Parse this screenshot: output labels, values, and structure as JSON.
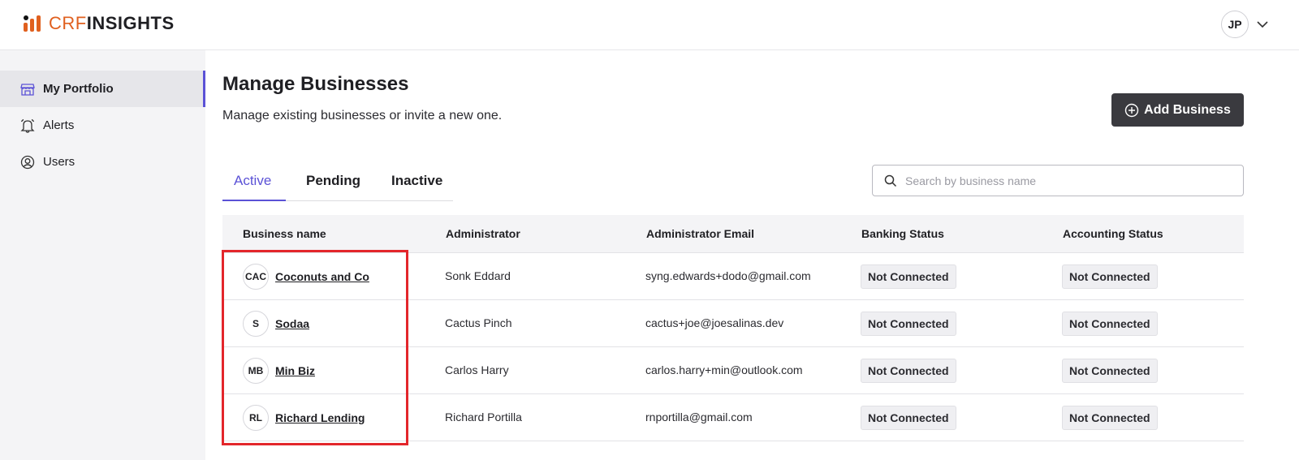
{
  "brand": {
    "part1": "CRF",
    "part2": "INSIGHTS",
    "accent": "#e0601f"
  },
  "user": {
    "initials": "JP"
  },
  "sidebar": {
    "items": [
      {
        "label": "My Portfolio",
        "icon": "storefront-icon",
        "active": true
      },
      {
        "label": "Alerts",
        "icon": "bell-icon",
        "active": false
      },
      {
        "label": "Users",
        "icon": "user-circle-icon",
        "active": false
      }
    ]
  },
  "page": {
    "title": "Manage Businesses",
    "subtitle": "Manage existing businesses or invite a new one.",
    "add_button": "Add Business"
  },
  "tabs": [
    {
      "label": "Active",
      "active": true
    },
    {
      "label": "Pending",
      "active": false
    },
    {
      "label": "Inactive",
      "active": false
    }
  ],
  "search": {
    "placeholder": "Search by business name",
    "value": ""
  },
  "table": {
    "columns": [
      "Business name",
      "Administrator",
      "Administrator Email",
      "Banking Status",
      "Accounting Status"
    ],
    "rows": [
      {
        "initials": "CAC",
        "name": "Coconuts and Co",
        "admin": "Sonk Eddard",
        "email": "syng.edwards+dodo@gmail.com",
        "banking": "Not Connected",
        "accounting": "Not Connected"
      },
      {
        "initials": "S",
        "name": "Sodaa",
        "admin": "Cactus Pinch",
        "email": "cactus+joe@joesalinas.dev",
        "banking": "Not Connected",
        "accounting": "Not Connected"
      },
      {
        "initials": "MB",
        "name": "Min Biz",
        "admin": "Carlos Harry",
        "email": "carlos.harry+min@outlook.com",
        "banking": "Not Connected",
        "accounting": "Not Connected"
      },
      {
        "initials": "RL",
        "name": "Richard Lending",
        "admin": "Richard Portilla",
        "email": "rnportilla@gmail.com",
        "banking": "Not Connected",
        "accounting": "Not Connected"
      }
    ]
  },
  "colors": {
    "tab_active": "#5b52d6",
    "button_bg": "#3a3a3f",
    "highlight": "#e3262b"
  }
}
